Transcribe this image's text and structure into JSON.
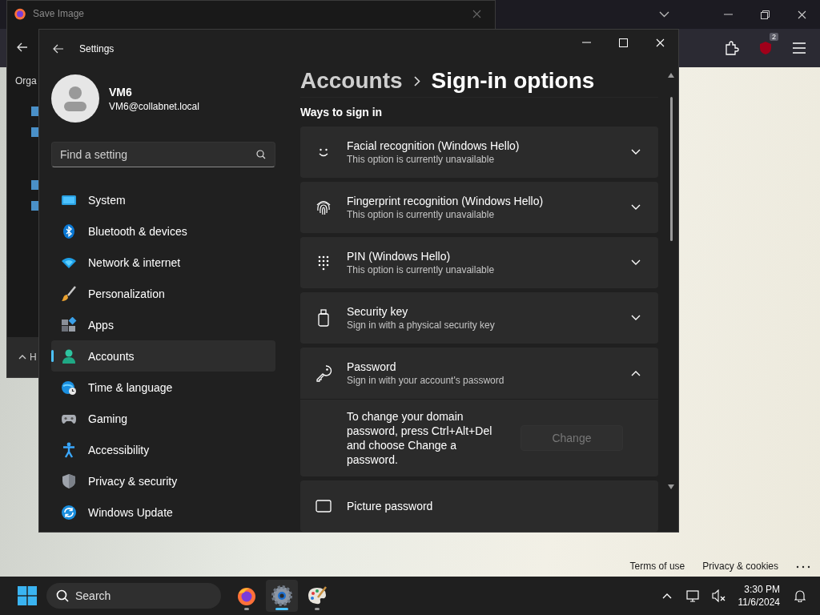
{
  "browser": {
    "badge": "2",
    "footer_links": [
      "Terms of use",
      "Privacy & cookies"
    ]
  },
  "save_dialog": {
    "title": "Save Image",
    "toolbar_button": "Orga",
    "folders_toggle": "H"
  },
  "settings": {
    "title": "Settings",
    "user": {
      "name": "VM6",
      "email": "VM6@collabnet.local"
    },
    "search": {
      "placeholder": "Find a setting"
    },
    "nav": [
      {
        "kind": "system",
        "label": "System",
        "selected": false
      },
      {
        "kind": "bluetooth",
        "label": "Bluetooth & devices",
        "selected": false
      },
      {
        "kind": "network",
        "label": "Network & internet",
        "selected": false
      },
      {
        "kind": "personalization",
        "label": "Personalization",
        "selected": false
      },
      {
        "kind": "apps",
        "label": "Apps",
        "selected": false
      },
      {
        "kind": "accounts",
        "label": "Accounts",
        "selected": true
      },
      {
        "kind": "time",
        "label": "Time & language",
        "selected": false
      },
      {
        "kind": "gaming",
        "label": "Gaming",
        "selected": false
      },
      {
        "kind": "accessibility",
        "label": "Accessibility",
        "selected": false
      },
      {
        "kind": "privacy",
        "label": "Privacy & security",
        "selected": false
      },
      {
        "kind": "update",
        "label": "Windows Update",
        "selected": false
      }
    ],
    "breadcrumb": {
      "parent": "Accounts",
      "current": "Sign-in options"
    },
    "section_title": "Ways to sign in",
    "options": [
      {
        "kind": "face",
        "title": "Facial recognition (Windows Hello)",
        "subtitle": "This option is currently unavailable",
        "expanded": false
      },
      {
        "kind": "fingerprint",
        "title": "Fingerprint recognition (Windows Hello)",
        "subtitle": "This option is currently unavailable",
        "expanded": false
      },
      {
        "kind": "pin",
        "title": "PIN (Windows Hello)",
        "subtitle": "This option is currently unavailable",
        "expanded": false
      },
      {
        "kind": "security-key",
        "title": "Security key",
        "subtitle": "Sign in with a physical security key",
        "expanded": false
      },
      {
        "kind": "password",
        "title": "Password",
        "subtitle": "Sign in with your account's password",
        "expanded": true,
        "detail": {
          "text": "To change your domain password, press Ctrl+Alt+Del and choose Change a password.",
          "button": "Change",
          "button_disabled": true
        }
      },
      {
        "kind": "picture",
        "title": "Picture password"
      }
    ]
  },
  "taskbar": {
    "search_placeholder": "Search",
    "apps": [
      {
        "kind": "firefox",
        "selected": false
      },
      {
        "kind": "settings",
        "selected": true
      },
      {
        "kind": "paint",
        "selected": false
      }
    ],
    "time": "3:30 PM",
    "date": "11/6/2024"
  }
}
